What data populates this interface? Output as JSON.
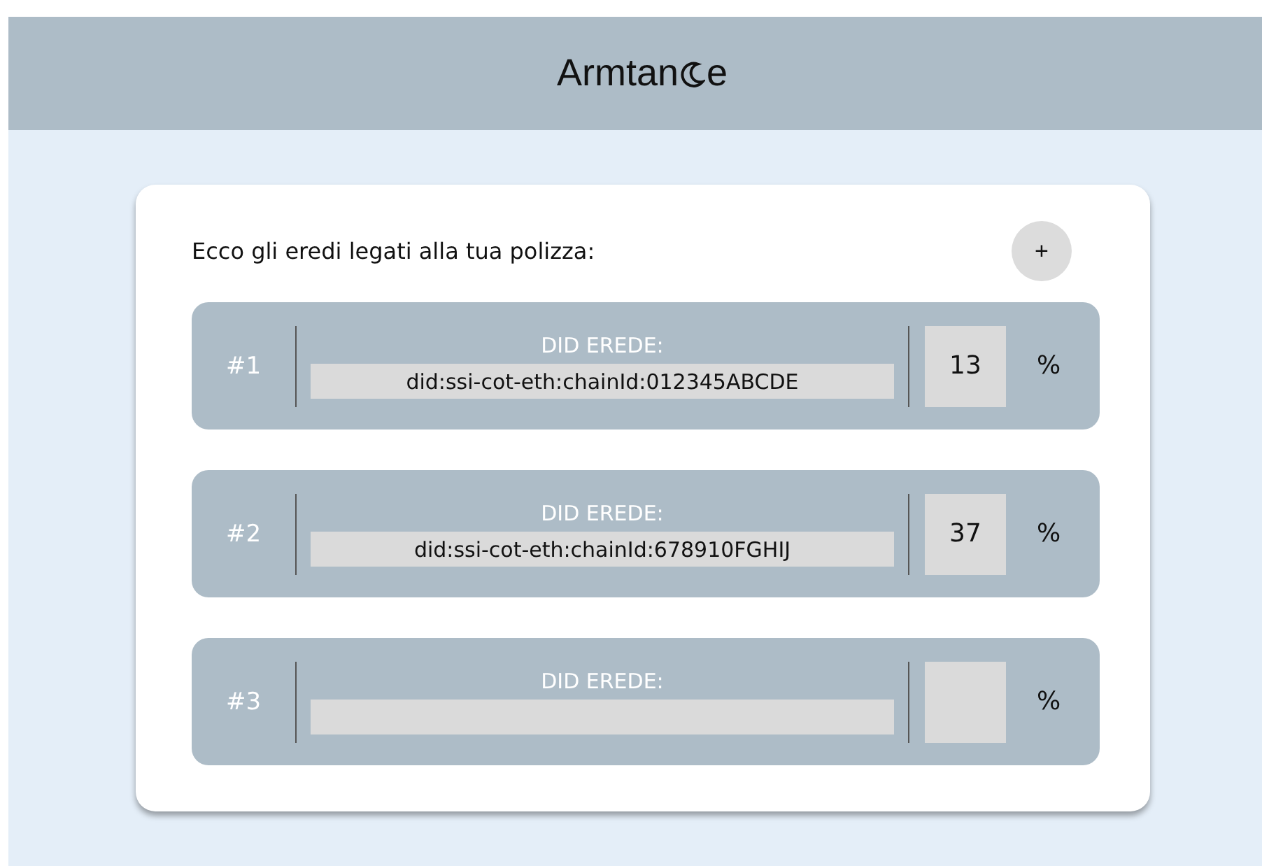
{
  "header": {
    "logo_start": "Armtan",
    "logo_end": "e"
  },
  "card": {
    "intro": "Ecco gli eredi legati alla tua polizza:",
    "add_button": "+",
    "heirs": [
      {
        "number": "#1",
        "did_label": "DID EREDE:",
        "did_value": "did:ssi-cot-eth:chainId:012345ABCDE",
        "percent": "13",
        "percent_sign": "%"
      },
      {
        "number": "#2",
        "did_label": "DID EREDE:",
        "did_value": "did:ssi-cot-eth:chainId:678910FGHIJ",
        "percent": "37",
        "percent_sign": "%"
      },
      {
        "number": "#3",
        "did_label": "DID EREDE:",
        "percent_sign": "%"
      }
    ]
  }
}
